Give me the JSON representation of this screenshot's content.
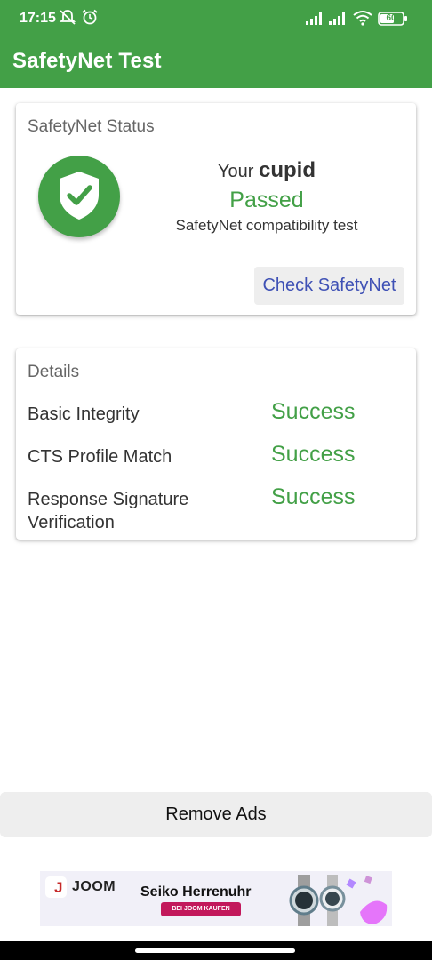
{
  "status_bar": {
    "time": "17:15",
    "battery": "60",
    "icons": [
      "mute-icon",
      "alarm-icon",
      "signal-icon",
      "signal-icon",
      "wifi-icon",
      "battery-icon"
    ]
  },
  "app_bar": {
    "title": "SafetyNet Test"
  },
  "status_card": {
    "title": "SafetyNet Status",
    "your_prefix": "Your",
    "device_name": "cupid",
    "result": "Passed",
    "subtitle": "SafetyNet compatibility test",
    "button_label": "Check SafetyNet",
    "icon": "shield-check-icon",
    "accent_color": "#43a047"
  },
  "details_card": {
    "title": "Details",
    "rows": [
      {
        "label": "Basic Integrity",
        "value": "Success"
      },
      {
        "label": "CTS Profile Match",
        "value": "Success"
      },
      {
        "label": "Response Signature Verification",
        "value": "Success"
      }
    ]
  },
  "remove_ads": {
    "label": "Remove Ads"
  },
  "ad": {
    "brand": "JOOM",
    "logo_mark": "J",
    "headline": "Seiko Herrenuhr",
    "cta": "BEI JOOM KAUFEN"
  }
}
